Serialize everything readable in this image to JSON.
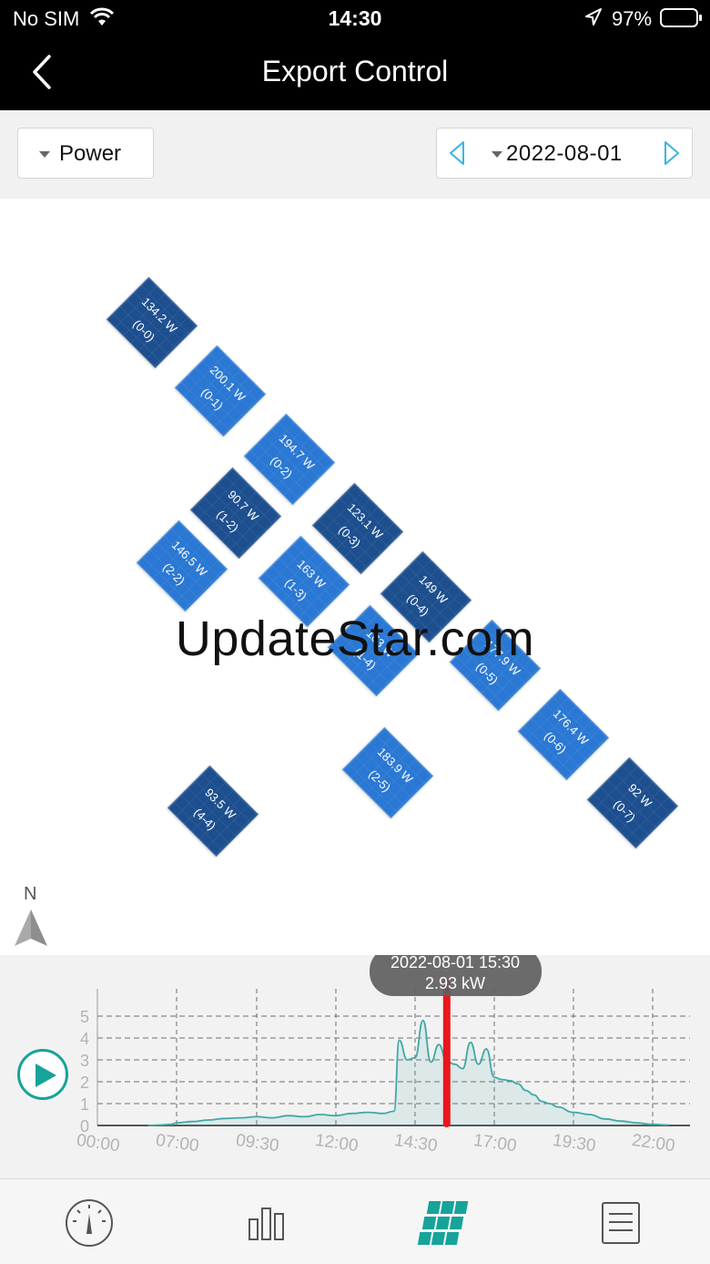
{
  "status": {
    "carrier": "No SIM",
    "time": "14:30",
    "battery": "97%"
  },
  "nav": {
    "title": "Export Control"
  },
  "filter": {
    "metric_label": "Power",
    "date": "2022-08-01"
  },
  "panels": [
    {
      "power": "134.2 W",
      "id": "(0-0)",
      "shade": "dark"
    },
    {
      "power": "200.1 W",
      "id": "(0-1)",
      "shade": "light"
    },
    {
      "power": "194.7 W",
      "id": "(0-2)",
      "shade": "light"
    },
    {
      "power": "123.1 W",
      "id": "(0-3)",
      "shade": "dark"
    },
    {
      "power": "149 W",
      "id": "(0-4)",
      "shade": "dark"
    },
    {
      "power": "177.9 W",
      "id": "(0-5)",
      "shade": "light"
    },
    {
      "power": "176.4 W",
      "id": "(0-6)",
      "shade": "light"
    },
    {
      "power": "92 W",
      "id": "(0-7)",
      "shade": "dark"
    },
    {
      "power": "90.7 W",
      "id": "(1-2)",
      "shade": "dark"
    },
    {
      "power": "163 W",
      "id": "(1-3)",
      "shade": "light"
    },
    {
      "power": "163 W",
      "id": "(1-4)",
      "shade": "light"
    },
    {
      "power": "146.5 W",
      "id": "(2-2)",
      "shade": "light"
    },
    {
      "power": "183.9 W",
      "id": "(2-5)",
      "shade": "light"
    },
    {
      "power": "93.5 W",
      "id": "(4-4)",
      "shade": "dark"
    }
  ],
  "watermark": "UpdateStar.com",
  "compass": {
    "label": "N"
  },
  "tooltip": {
    "datetime": "2022-08-01 15:30",
    "value": "2.93 kW"
  },
  "colors": {
    "accent": "#16a39a",
    "panel_light": "#2a78d4",
    "panel_dark": "#1d4f8f",
    "cursor": "#e8171c",
    "line": "#3fa9a6"
  },
  "chart_data": {
    "type": "area",
    "xlabel": "",
    "ylabel": "",
    "x_ticks": [
      "00:00",
      "07:00",
      "09:30",
      "12:00",
      "14:30",
      "17:00",
      "19:30",
      "22:00"
    ],
    "y_ticks": [
      0,
      1,
      2,
      3,
      4,
      5
    ],
    "ylim": [
      0,
      5.5
    ],
    "x": [
      "04:30",
      "05:30",
      "06:30",
      "07:00",
      "07:30",
      "08:00",
      "08:30",
      "09:00",
      "09:30",
      "10:00",
      "10:30",
      "11:00",
      "11:30",
      "12:00",
      "12:30",
      "13:00",
      "13:30",
      "13:50",
      "14:00",
      "14:15",
      "14:30",
      "14:45",
      "15:00",
      "15:15",
      "15:30",
      "15:45",
      "16:00",
      "16:15",
      "16:30",
      "16:45",
      "17:00",
      "17:15",
      "17:30",
      "17:45",
      "18:00",
      "18:15",
      "18:30",
      "18:45",
      "19:00",
      "19:30",
      "20:00",
      "20:30",
      "21:00",
      "21:30",
      "22:00",
      "22:30"
    ],
    "values": [
      0,
      0.02,
      0.05,
      0.12,
      0.18,
      0.25,
      0.32,
      0.35,
      0.4,
      0.35,
      0.45,
      0.4,
      0.5,
      0.45,
      0.55,
      0.6,
      0.55,
      0.65,
      3.9,
      3.0,
      3.1,
      4.8,
      2.9,
      3.7,
      2.93,
      2.8,
      2.6,
      3.8,
      2.8,
      3.5,
      2.2,
      2.1,
      2.05,
      1.9,
      1.6,
      1.4,
      1.1,
      1.0,
      0.85,
      0.6,
      0.5,
      0.3,
      0.2,
      0.12,
      0.05,
      0.02
    ],
    "cursor_x": "15:30",
    "grid": "dashed",
    "fill": true
  }
}
